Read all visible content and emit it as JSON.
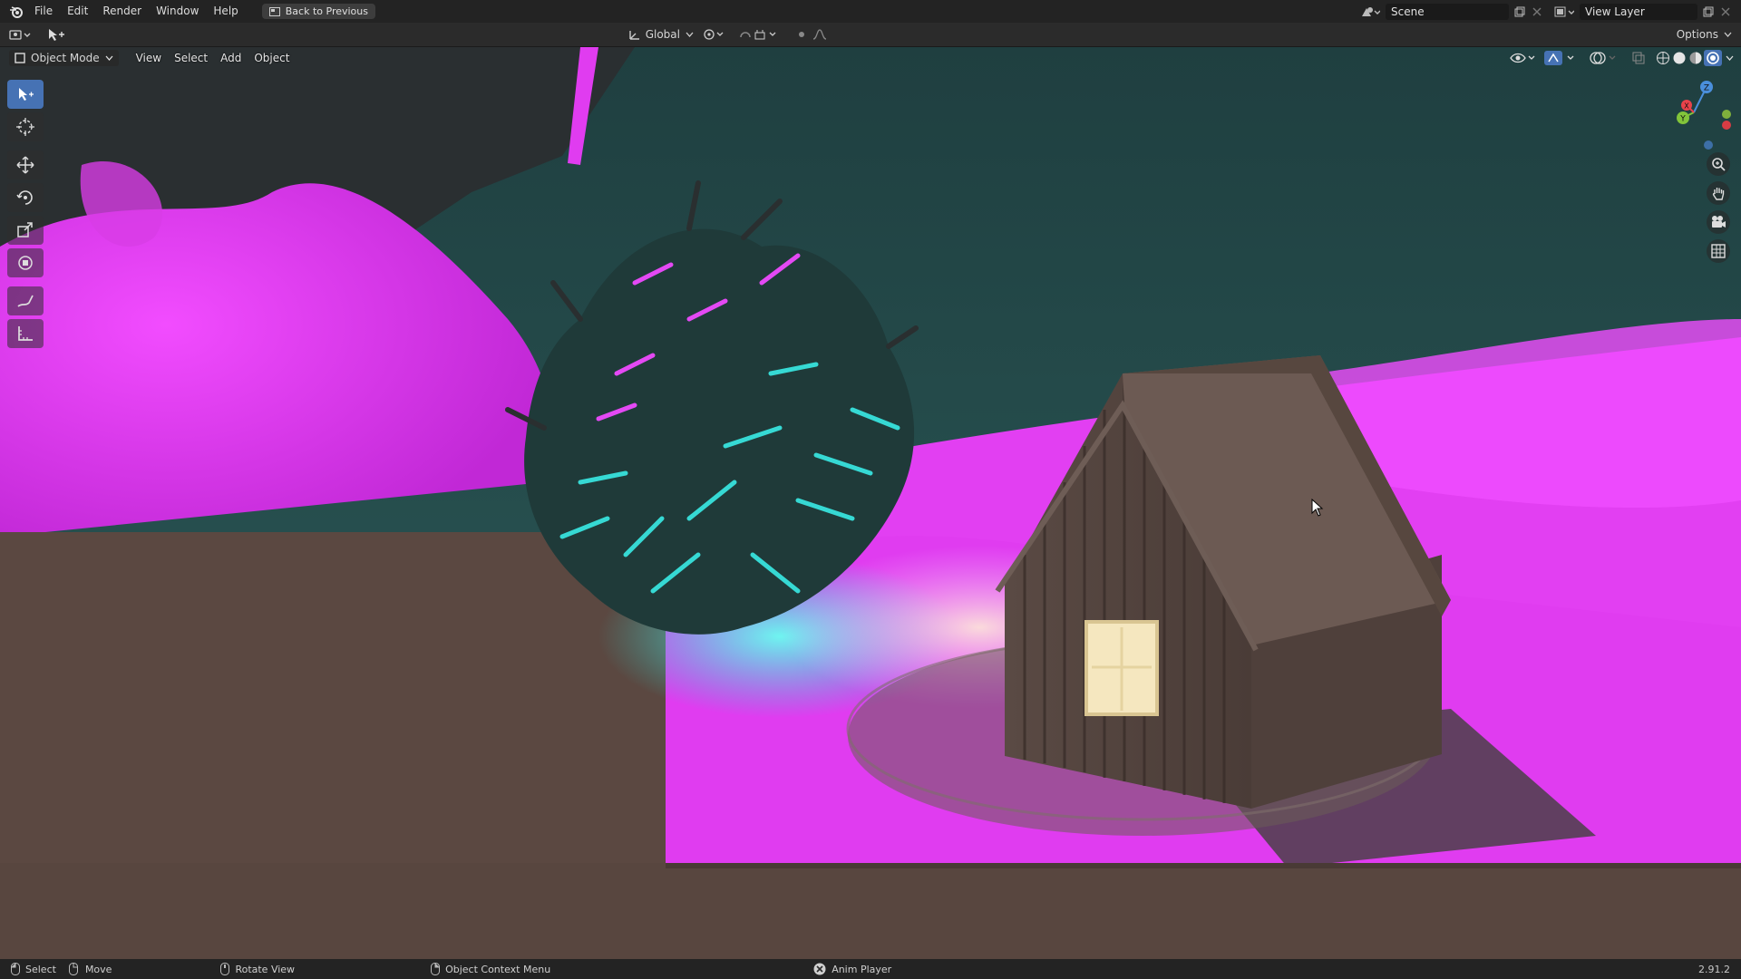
{
  "menubar": {
    "items": [
      "File",
      "Edit",
      "Render",
      "Window",
      "Help"
    ],
    "back_button": "Back to Previous",
    "scene_label": "Scene",
    "view_layer_label": "View Layer"
  },
  "toolheader": {
    "transform_orientation": "Global",
    "options_label": "Options"
  },
  "viewport": {
    "mode": "Object Mode",
    "menus": [
      "View",
      "Select",
      "Add",
      "Object"
    ],
    "tools": [
      "select-box-tool",
      "cursor-tool",
      "move-tool",
      "rotate-tool",
      "scale-tool",
      "transform-tool",
      "annotate-tool",
      "measure-tool"
    ],
    "gizmo_axes": [
      "X",
      "Y",
      "Z"
    ]
  },
  "statusbar": {
    "select": "Select",
    "move": "Move",
    "rotate_view": "Rotate View",
    "context_menu": "Object Context Menu",
    "anim_player": "Anim Player",
    "version": "2.91.2"
  },
  "colors": {
    "accent": "#4672b4",
    "magenta": "#e03cf0",
    "teal": "#2ad8d2",
    "ground": "#5a4741",
    "sky": "#244c4e"
  }
}
